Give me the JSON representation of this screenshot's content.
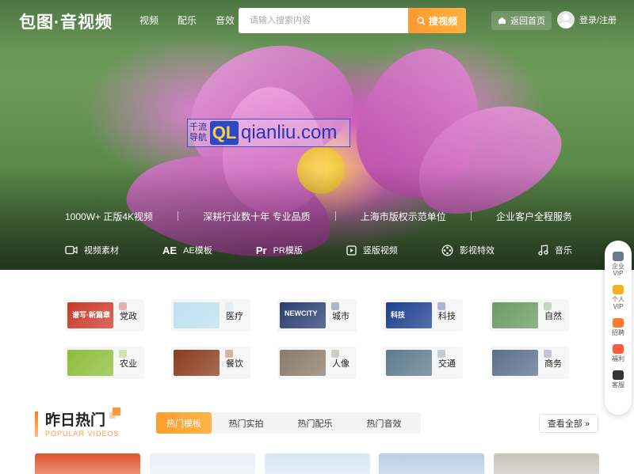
{
  "header": {
    "logo": "包图·音视频",
    "nav": [
      "视频",
      "配乐",
      "音效"
    ],
    "search_placeholder": "请输入搜索内容",
    "search_button": "搜视频",
    "home_button": "返回首页",
    "login": "登录/注册"
  },
  "watermark": {
    "cn_line1": "千流",
    "cn_line2": "导航",
    "badge": "QL",
    "url": "qianliu.com"
  },
  "hero": {
    "features": [
      "1000W+ 正版4K视频",
      "深耕行业数十年 专业品质",
      "上海市版权示范单位",
      "企业客户全程服务"
    ],
    "categories": [
      {
        "icon": "video-camera-icon",
        "label": "视频素材"
      },
      {
        "icon_text": "AE",
        "label": "AE模板"
      },
      {
        "icon_text": "Pr",
        "label": "PR模版"
      },
      {
        "icon": "play-square-icon",
        "label": "竖版视频"
      },
      {
        "icon": "film-reel-icon",
        "label": "影视特效"
      },
      {
        "icon": "music-note-icon",
        "label": "音乐"
      }
    ]
  },
  "sidebar": [
    {
      "label1": "企业",
      "label2": "VIP",
      "color": "#6b7a8f"
    },
    {
      "label1": "个人",
      "label2": "VIP",
      "color": "#f5b21c"
    },
    {
      "label1": "招聘",
      "label2": "",
      "color": "#ff7b2a"
    },
    {
      "label1": "福利",
      "label2": "",
      "color": "#ff5a3a"
    },
    {
      "label1": "客服",
      "label2": "",
      "color": "#333333"
    }
  ],
  "tiles": [
    {
      "name": "党政",
      "thumb": "#c93a2a"
    },
    {
      "name": "医疗",
      "thumb": "#bfe0f0"
    },
    {
      "name": "城市",
      "thumb": "#2a3e72"
    },
    {
      "name": "科技",
      "thumb": "#1d3f8f"
    },
    {
      "name": "自然",
      "thumb": "#6a9b62"
    },
    {
      "name": "农业",
      "thumb": "#8dbd3a"
    },
    {
      "name": "餐饮",
      "thumb": "#8a3c1c"
    },
    {
      "name": "人像",
      "thumb": "#8a7a6a"
    },
    {
      "name": "交通",
      "thumb": "#5e7a8c"
    },
    {
      "name": "商务",
      "thumb": "#5c6f8c"
    }
  ],
  "tile_thumb_texts": {
    "0": "谱写·新篇章",
    "2": "NEWCITY",
    "3": "科技"
  },
  "hot": {
    "title": "昨日热门",
    "subtitle": "POPULAR VIDEOS",
    "tabs": [
      "热门模板",
      "热门实拍",
      "热门配乐",
      "热门音效"
    ],
    "active_tab": 0,
    "view_all": "查看全部 »"
  },
  "cards": [
    "#e0542a",
    "#e9f0f7",
    "#d7e8f5",
    "#b9cde4",
    "#c9c2ba"
  ],
  "colors": {
    "accent": "#ff9c2f"
  }
}
